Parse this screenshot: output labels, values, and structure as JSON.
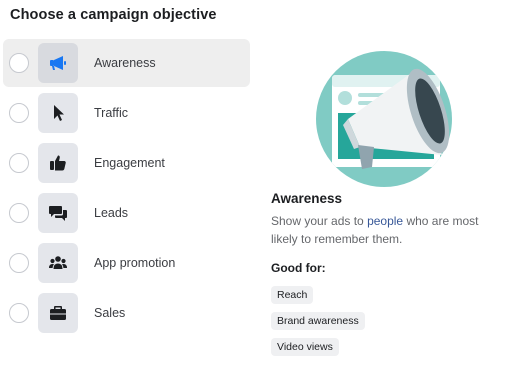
{
  "header": {
    "title": "Choose a campaign objective"
  },
  "objectives": [
    {
      "label": "Awareness",
      "icon": "megaphone-icon",
      "selected": true
    },
    {
      "label": "Traffic",
      "icon": "cursor-icon",
      "selected": false
    },
    {
      "label": "Engagement",
      "icon": "thumbs-up-icon",
      "selected": false
    },
    {
      "label": "Leads",
      "icon": "chat-bubbles-icon",
      "selected": false
    },
    {
      "label": "App promotion",
      "icon": "people-icon",
      "selected": false
    },
    {
      "label": "Sales",
      "icon": "briefcase-icon",
      "selected": false
    }
  ],
  "detail": {
    "title": "Awareness",
    "desc_before": "Show your ads to ",
    "desc_link": "people",
    "desc_after": " who are most likely to remember them.",
    "good_for_label": "Good for:",
    "tags": [
      "Reach",
      "Brand awareness",
      "Video views"
    ]
  },
  "colors": {
    "accent_blue": "#1877f2",
    "illustration_teal": "#26a69a",
    "illustration_bg": "#80cbc4",
    "link": "#385898"
  }
}
